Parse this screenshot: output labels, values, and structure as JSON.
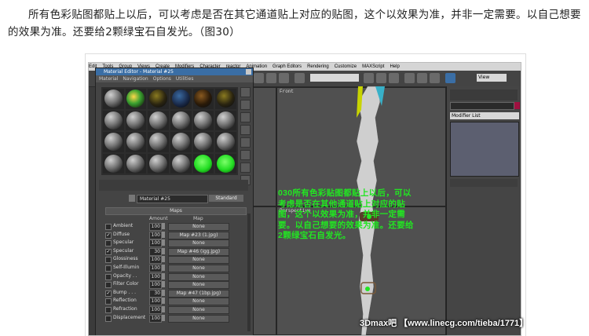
{
  "article": {
    "paragraph": "所有色彩贴图都贴上以后，可以考虑是否在其它通道贴上对应的贴图，这个以效果为准，并非一定需要。以自己想要的效果为准。还要给2颗绿宝石自发光。（图30）"
  },
  "app": {
    "menu": [
      "Edit",
      "Tools",
      "Group",
      "Views",
      "Create",
      "Modifiers",
      "Character",
      "reactor",
      "Animation",
      "Graph Editors",
      "Rendering",
      "Customize",
      "MAXScript",
      "Help"
    ],
    "view_dropdown": "View",
    "viewports": {
      "front_label": "Front",
      "perspective_label": "Perspective"
    },
    "command_panel": {
      "modifier_list": "Modifier List"
    }
  },
  "material_editor": {
    "title": "Material Editor - Material #25",
    "menu": [
      "Material",
      "Navigation",
      "Options",
      "Utilities"
    ],
    "material_name": "Material #25",
    "type_button": "Standard",
    "maps_rollout": "Maps",
    "columns": {
      "amount": "Amount",
      "map": "Map"
    },
    "slot_colors": [
      "grey",
      "green-glow",
      "dark-yellow",
      "blue",
      "dark-orange",
      "dark-yellow",
      "grey",
      "grey",
      "grey",
      "grey",
      "grey",
      "grey",
      "grey",
      "grey",
      "grey",
      "grey",
      "grey",
      "grey",
      "grey",
      "grey",
      "grey",
      "grey",
      "green",
      "green"
    ],
    "maps": [
      {
        "label": "Ambient",
        "checked": false,
        "amount": "100",
        "map": "None"
      },
      {
        "label": "Diffuse",
        "checked": true,
        "amount": "100",
        "map": "Map #23 (1.jpg)"
      },
      {
        "label": "Specular",
        "checked": false,
        "amount": "100",
        "map": "None"
      },
      {
        "label": "Specular",
        "checked": true,
        "amount": "30",
        "map": "Map #46 (igg.jpg)"
      },
      {
        "label": "Glossiness",
        "checked": false,
        "amount": "100",
        "map": "None"
      },
      {
        "label": "Self-Illumin",
        "checked": false,
        "amount": "100",
        "map": "None"
      },
      {
        "label": "Opacity . .",
        "checked": false,
        "amount": "100",
        "map": "None"
      },
      {
        "label": "Filter Color",
        "checked": false,
        "amount": "100",
        "map": "None"
      },
      {
        "label": "Bump . . .",
        "checked": true,
        "amount": "30",
        "map": "Map #47 (1bp.jpg)"
      },
      {
        "label": "Reflection",
        "checked": false,
        "amount": "100",
        "map": "None"
      },
      {
        "label": "Refraction",
        "checked": false,
        "amount": "100",
        "map": "None"
      },
      {
        "label": "Displacement",
        "checked": false,
        "amount": "100",
        "map": "None"
      }
    ]
  },
  "overlay_caption": "030所有色彩贴图都贴上以后，可以考虑是否在其他通道贴上对应的贴图，这个以效果为准，并非一定需要。以自己想要的效果为准。还要给2颗绿宝石自发光。",
  "watermark": "3Dmax吧 【www.linecg.com/tieba/1771】",
  "colors": {
    "accent_green": "#22e622",
    "title_blue": "#3a6ea5"
  }
}
